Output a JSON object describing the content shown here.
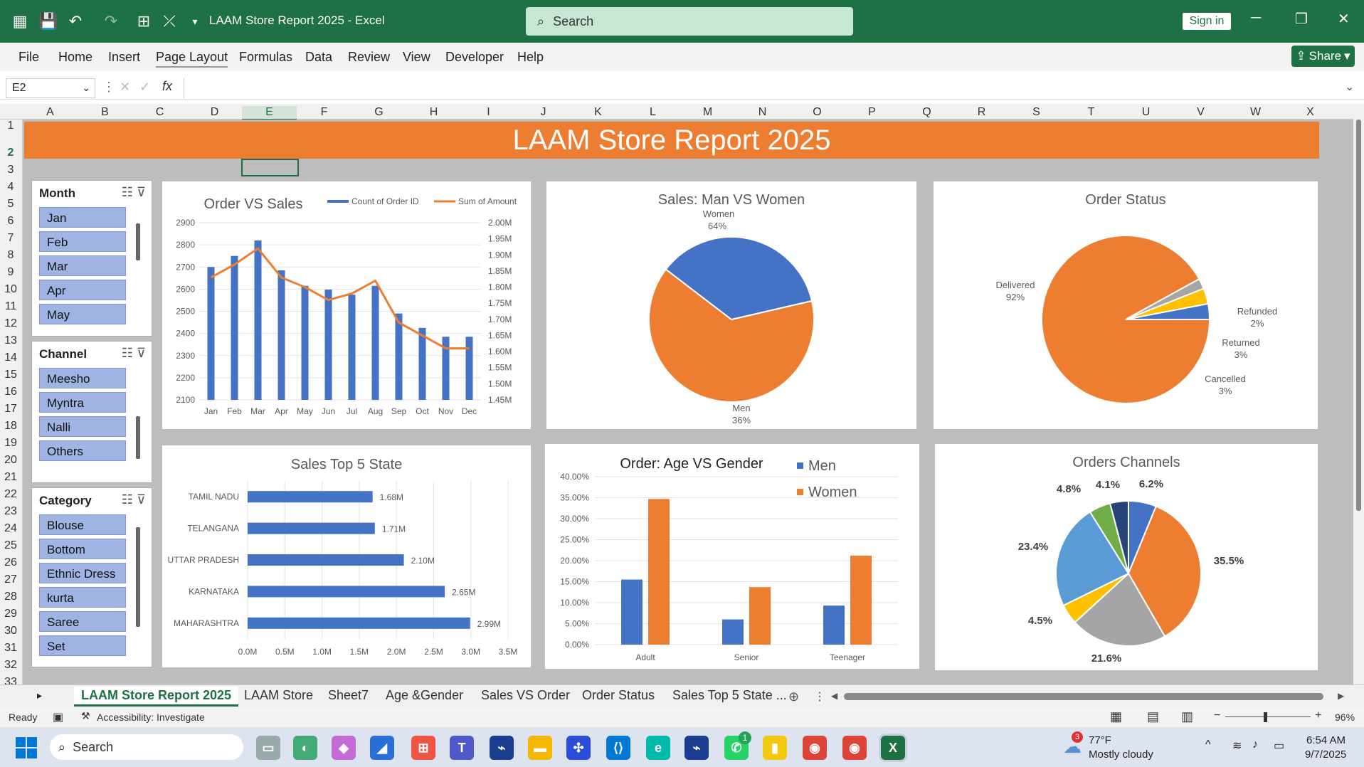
{
  "window": {
    "title": "LAAM Store Report 2025  -  Excel",
    "search_placeholder": "Search",
    "signin": "Sign in"
  },
  "menu": {
    "items": [
      "File",
      "Home",
      "Insert",
      "Page Layout",
      "Formulas",
      "Data",
      "Review",
      "View",
      "Developer",
      "Help"
    ],
    "share": "Share"
  },
  "formula": {
    "cell_ref": "E2",
    "fx": "fx"
  },
  "columns": [
    "A",
    "B",
    "C",
    "D",
    "E",
    "F",
    "G",
    "H",
    "I",
    "J",
    "K",
    "L",
    "M",
    "N",
    "O",
    "P",
    "Q",
    "R",
    "S",
    "T",
    "U",
    "V",
    "W",
    "X"
  ],
  "rows": [
    "1",
    "2",
    "3",
    "4",
    "5",
    "6",
    "7",
    "8",
    "9",
    "10",
    "11",
    "12",
    "13",
    "14",
    "15",
    "16",
    "17",
    "18",
    "19",
    "20",
    "21",
    "22",
    "23",
    "24",
    "25",
    "26",
    "27",
    "28",
    "29",
    "30",
    "31",
    "32",
    "33"
  ],
  "banner": "LAAM Store Report 2025",
  "slicers": {
    "month": {
      "title": "Month",
      "items": [
        "Jan",
        "Feb",
        "Mar",
        "Apr",
        "May"
      ]
    },
    "channel": {
      "title": "Channel",
      "items": [
        "Meesho",
        "Myntra",
        "Nalli",
        "Others"
      ]
    },
    "category": {
      "title": "Category",
      "items": [
        "Blouse",
        "Bottom",
        "Ethnic Dress",
        "kurta",
        "Saree",
        "Set"
      ]
    }
  },
  "chart_data": [
    {
      "type": "bar",
      "title": "Order VS  Sales",
      "categories": [
        "Jan",
        "Feb",
        "Mar",
        "Apr",
        "May",
        "Jun",
        "Jul",
        "Aug",
        "Sep",
        "Oct",
        "Nov",
        "Dec"
      ],
      "series": [
        {
          "name": "Count of Order ID",
          "values": [
            2700,
            2750,
            2820,
            2685,
            2615,
            2598,
            2575,
            2615,
            2490,
            2425,
            2385,
            2385
          ]
        },
        {
          "name": "Sum of Amount",
          "values": [
            1.83,
            1.87,
            1.92,
            1.83,
            1.8,
            1.76,
            1.78,
            1.82,
            1.69,
            1.65,
            1.61,
            1.61
          ]
        }
      ],
      "ylim": [
        2100,
        2900
      ],
      "y2lim": [
        1.45,
        2.0
      ],
      "yticks": [
        "2900",
        "2800",
        "2700",
        "2600",
        "2500",
        "2400",
        "2300",
        "2200",
        "2100"
      ],
      "y2ticks": [
        "2.00M",
        "1.95M",
        "1.90M",
        "1.85M",
        "1.80M",
        "1.75M",
        "1.70M",
        "1.65M",
        "1.60M",
        "1.55M",
        "1.50M",
        "1.45M"
      ],
      "legend_position": "top-right",
      "colors": [
        "#4472c4",
        "#ed7d31"
      ]
    },
    {
      "type": "pie",
      "title": "Sales: Man VS Women",
      "slices": [
        {
          "name": "Women",
          "value": 64,
          "label": "64%"
        },
        {
          "name": "Men",
          "value": 36,
          "label": "36%"
        }
      ],
      "colors": [
        "#ed7d31",
        "#4472c4"
      ]
    },
    {
      "type": "pie",
      "title": "Order Status",
      "slices": [
        {
          "name": "Delivered",
          "value": 92,
          "label": "92%"
        },
        {
          "name": "Refunded",
          "value": 2,
          "label": "2%"
        },
        {
          "name": "Returned",
          "value": 3,
          "label": "3%"
        },
        {
          "name": "Cancelled",
          "value": 3,
          "label": "3%"
        }
      ],
      "colors": [
        "#ed7d31",
        "#a5a5a5",
        "#ffc000",
        "#4472c4"
      ]
    },
    {
      "type": "bar",
      "orientation": "horizontal",
      "title": "Sales Top 5 State",
      "categories": [
        "TAMIL NADU",
        "TELANGANA",
        "UTTAR PRADESH",
        "KARNATAKA",
        "MAHARASHTRA"
      ],
      "values": [
        1.68,
        1.71,
        2.1,
        2.65,
        2.99
      ],
      "data_labels": [
        "1.68M",
        "1.71M",
        "2.10M",
        "2.65M",
        "2.99M"
      ],
      "xlim": [
        0,
        3.5
      ],
      "xticks": [
        "0.0M",
        "0.5M",
        "1.0M",
        "1.5M",
        "2.0M",
        "2.5M",
        "3.0M",
        "3.5M"
      ],
      "colors": [
        "#4472c4"
      ]
    },
    {
      "type": "bar",
      "title": "Order: Age VS Gender",
      "categories": [
        "Adult",
        "Senior",
        "Teenager"
      ],
      "series": [
        {
          "name": "Men",
          "values": [
            15.5,
            6,
            9.3
          ]
        },
        {
          "name": "Women",
          "values": [
            34.7,
            13.7,
            21.2
          ]
        }
      ],
      "ylim": [
        0,
        40
      ],
      "yticks": [
        "40.00%",
        "35.00%",
        "30.00%",
        "25.00%",
        "20.00%",
        "15.00%",
        "10.00%",
        "5.00%",
        "0.00%"
      ],
      "legend_position": "top-right",
      "colors": [
        "#4472c4",
        "#ed7d31"
      ]
    },
    {
      "type": "pie",
      "title": "Orders Channels",
      "slices": [
        {
          "value": 6.2,
          "label": "6.2%"
        },
        {
          "value": 35.5,
          "label": "35.5%"
        },
        {
          "value": 21.6,
          "label": "21.6%"
        },
        {
          "value": 4.5,
          "label": "4.5%"
        },
        {
          "value": 23.4,
          "label": "23.4%"
        },
        {
          "value": 4.8,
          "label": "4.8%"
        },
        {
          "value": 4.1,
          "label": "4.1%"
        }
      ],
      "colors": [
        "#4472c4",
        "#ed7d31",
        "#a5a5a5",
        "#ffc000",
        "#5b9bd5",
        "#70ad47",
        "#264478"
      ]
    }
  ],
  "tabs": [
    "LAAM Store Report 2025",
    "LAAM Store",
    "Sheet7",
    "Age &Gender",
    "Sales VS Order",
    "Order Status",
    "Sales Top 5 State ..."
  ],
  "status": {
    "ready": "Ready",
    "accessibility": "Accessibility: Investigate",
    "zoom": "96%"
  },
  "taskbar": {
    "search": "Search",
    "weather_temp": "77°F",
    "weather_desc": "Mostly cloudy",
    "time": "6:54 AM",
    "date": "9/7/2025",
    "weather_badge": "3",
    "whatsapp_badge": "1"
  }
}
